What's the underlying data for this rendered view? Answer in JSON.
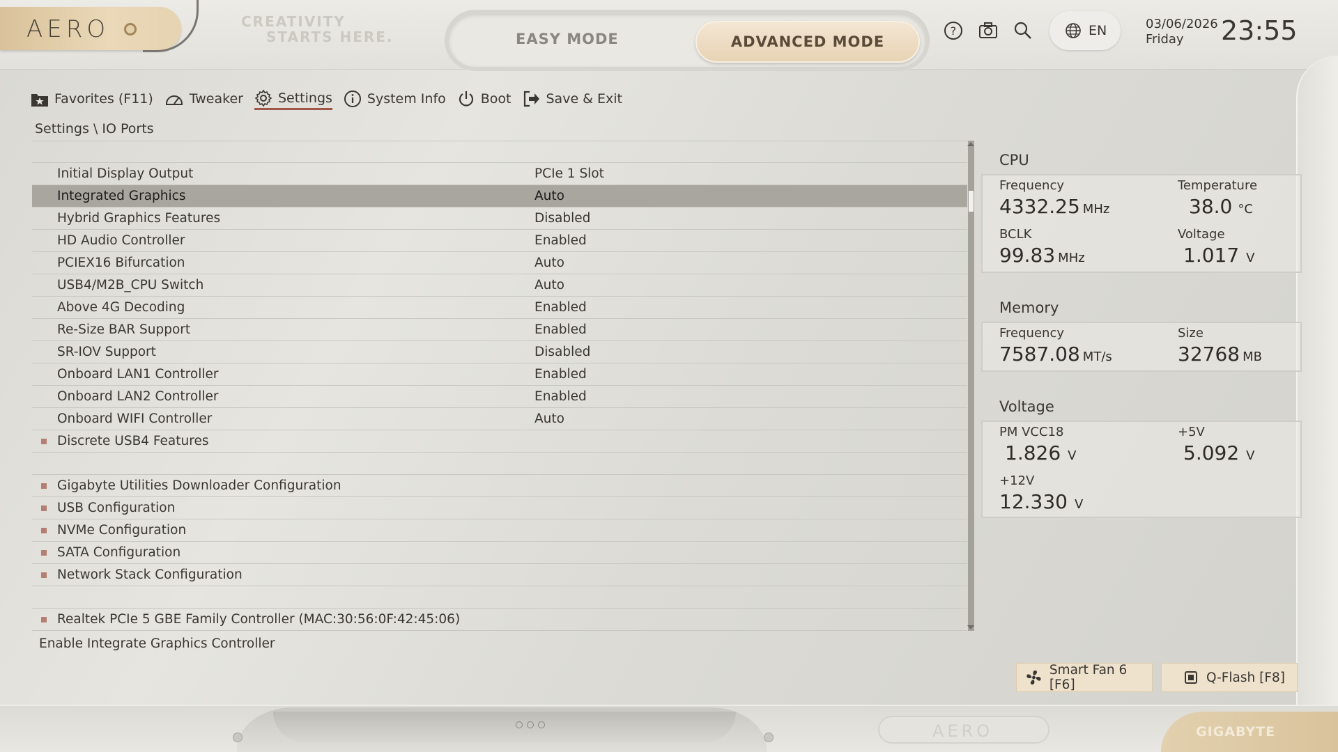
{
  "header": {
    "logo": "AERO",
    "tagline_line1": "CREATIVITY",
    "tagline_line2": "STARTS HERE.",
    "easy_mode": "EASY MODE",
    "advanced_mode": "ADVANCED MODE",
    "language": "EN",
    "date": "03/06/2026",
    "day": "Friday",
    "time": "23:55",
    "icons": [
      "help-icon",
      "screenshot-icon",
      "search-icon",
      "globe-icon"
    ]
  },
  "nav": [
    {
      "label": "Favorites (F11)",
      "icon": "star-folder-icon"
    },
    {
      "label": "Tweaker",
      "icon": "gauge-icon"
    },
    {
      "label": "Settings",
      "icon": "gear-icon",
      "active": true
    },
    {
      "label": "System Info",
      "icon": "info-icon"
    },
    {
      "label": "Boot",
      "icon": "power-icon"
    },
    {
      "label": "Save & Exit",
      "icon": "exit-icon"
    }
  ],
  "breadcrumb": "Settings \\ IO Ports",
  "settings_rows": [
    {
      "label": "Initial Display Output",
      "value": "PCIe 1 Slot"
    },
    {
      "label": "Integrated Graphics",
      "value": "Auto",
      "selected": true
    },
    {
      "label": "Hybrid Graphics Features",
      "value": "Disabled"
    },
    {
      "label": "HD Audio Controller",
      "value": "Enabled"
    },
    {
      "label": "PCIEX16 Bifurcation",
      "value": "Auto"
    },
    {
      "label": "USB4/M2B_CPU Switch",
      "value": "Auto"
    },
    {
      "label": "Above 4G Decoding",
      "value": "Enabled"
    },
    {
      "label": "Re-Size BAR Support",
      "value": "Enabled"
    },
    {
      "label": "SR-IOV Support",
      "value": "Disabled"
    },
    {
      "label": "Onboard LAN1 Controller",
      "value": "Enabled"
    },
    {
      "label": "Onboard LAN2 Controller",
      "value": "Enabled"
    },
    {
      "label": "Onboard WIFI Controller",
      "value": "Auto"
    },
    {
      "label": "Discrete USB4 Features",
      "value": "",
      "submenu": true
    },
    {
      "label": "",
      "value": ""
    },
    {
      "label": "Gigabyte Utilities Downloader Configuration",
      "value": "",
      "submenu": true
    },
    {
      "label": "USB Configuration",
      "value": "",
      "submenu": true
    },
    {
      "label": "NVMe Configuration",
      "value": "",
      "submenu": true
    },
    {
      "label": "SATA Configuration",
      "value": "",
      "submenu": true
    },
    {
      "label": "Network Stack Configuration",
      "value": "",
      "submenu": true
    },
    {
      "label": "",
      "value": ""
    },
    {
      "label": "Realtek PCIe 5 GBE Family Controller (MAC:30:56:0F:42:45:06)",
      "value": "",
      "submenu": true
    }
  ],
  "help_text": "Enable Integrate Graphics Controller",
  "cpu": {
    "title": "CPU",
    "frequency_label": "Frequency",
    "frequency": "4332.25",
    "frequency_unit": "MHz",
    "temperature_label": "Temperature",
    "temperature": "38.0",
    "temperature_unit": "°C",
    "bclk_label": "BCLK",
    "bclk": "99.83",
    "bclk_unit": "MHz",
    "voltage_label": "Voltage",
    "voltage": "1.017",
    "voltage_unit": "V"
  },
  "memory": {
    "title": "Memory",
    "frequency_label": "Frequency",
    "frequency": "7587.08",
    "frequency_unit": "MT/s",
    "size_label": "Size",
    "size": "32768",
    "size_unit": "MB"
  },
  "voltage": {
    "title": "Voltage",
    "vcc18_label": "PM VCC18",
    "vcc18": "1.826",
    "vcc18_unit": "V",
    "v5_label": "+5V",
    "v5": "5.092",
    "v5_unit": "V",
    "v12_label": "+12V",
    "v12": "12.330",
    "v12_unit": "V"
  },
  "buttons": {
    "smart_fan": "Smart Fan 6 [F6]",
    "qflash": "Q-Flash [F8]"
  },
  "footer": {
    "aero": "AERO",
    "brand": "GIGABYTE"
  },
  "colors": {
    "accent_gold": "#e8d3b4",
    "selected_row": "#a9a6a0",
    "bullet": "#b57e72",
    "active_tab_underline": "#a0574a"
  }
}
